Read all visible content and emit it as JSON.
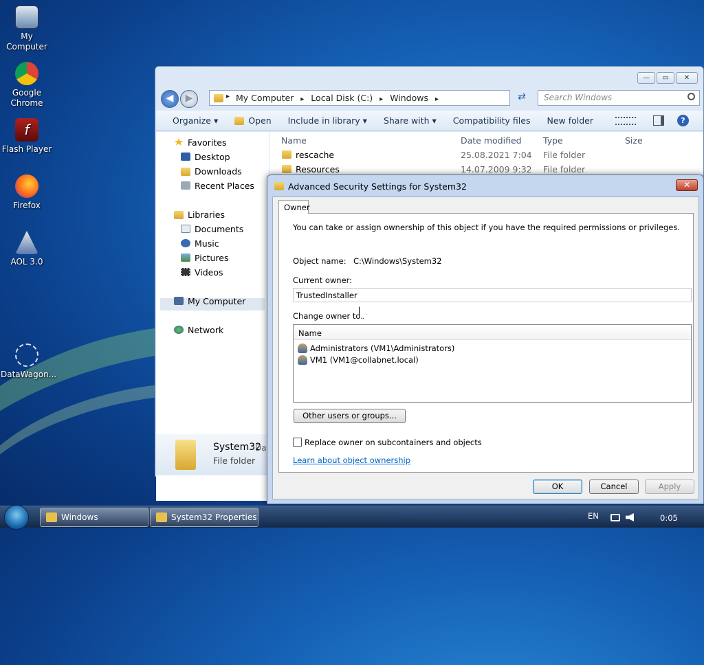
{
  "desktop": {
    "icons": [
      {
        "label": "My Computer"
      },
      {
        "label": "Google Chrome"
      },
      {
        "label": "Flash Player"
      },
      {
        "label": "Firefox"
      },
      {
        "label": "AOL 3.0"
      },
      {
        "label": "DataWagon..."
      }
    ]
  },
  "explorer": {
    "caption_min": "—",
    "caption_max": "▭",
    "caption_close": "✕",
    "back_glyph": "◀",
    "forward_glyph": "▶",
    "address": {
      "segments": [
        "My Computer",
        "Local Disk (C:)",
        "Windows"
      ],
      "sep": "▸"
    },
    "refresh_glyph": "⇄",
    "search_placeholder": "Search Windows",
    "toolbar": {
      "organize": "Organize ▾",
      "open": "Open",
      "include": "Include in library ▾",
      "share": "Share with ▾",
      "compat": "Compatibility files",
      "newfolder": "New folder",
      "help": "?"
    },
    "nav": {
      "favorites": "Favorites",
      "desktop": "Desktop",
      "downloads": "Downloads",
      "recent": "Recent Places",
      "libraries": "Libraries",
      "documents": "Documents",
      "music": "Music",
      "pictures": "Pictures",
      "videos": "Videos",
      "mycomputer": "My Computer",
      "network": "Network"
    },
    "columns": {
      "name": "Name",
      "date": "Date modified",
      "type": "Type",
      "size": "Size"
    },
    "files": [
      {
        "name": "rescache",
        "date": "25.08.2021 7:04",
        "type": "File folder"
      },
      {
        "name": "Resources",
        "date": "14.07.2009 9:32",
        "type": "File folder"
      }
    ],
    "details": {
      "name": "System32",
      "type": "File folder",
      "extra": "Dat"
    }
  },
  "dialog": {
    "title": "Advanced Security Settings for System32",
    "close_glyph": "✕",
    "tab": "Owner",
    "intro": "You can take or assign ownership of this object if you have the required permissions or privileges.",
    "object_name_label": "Object name:",
    "object_name_value": "C:\\Windows\\System32",
    "current_owner_label": "Current owner:",
    "current_owner_value": "TrustedInstaller",
    "change_owner_label": "Change owner to:",
    "list_header": "Name",
    "owners": [
      {
        "label": "Administrators (VM1\\Administrators)"
      },
      {
        "label": "VM1 (VM1@collabnet.local)"
      }
    ],
    "other_users_button": "Other users or groups...",
    "replace_owner_label": "Replace owner on subcontainers and objects",
    "learn_link": "Learn about object ownership",
    "ok": "OK",
    "cancel": "Cancel",
    "apply": "Apply"
  },
  "taskbar": {
    "tasks": [
      {
        "label": "Windows"
      },
      {
        "label": "System32 Properties"
      }
    ],
    "lang": "EN",
    "clock": "0:05"
  }
}
